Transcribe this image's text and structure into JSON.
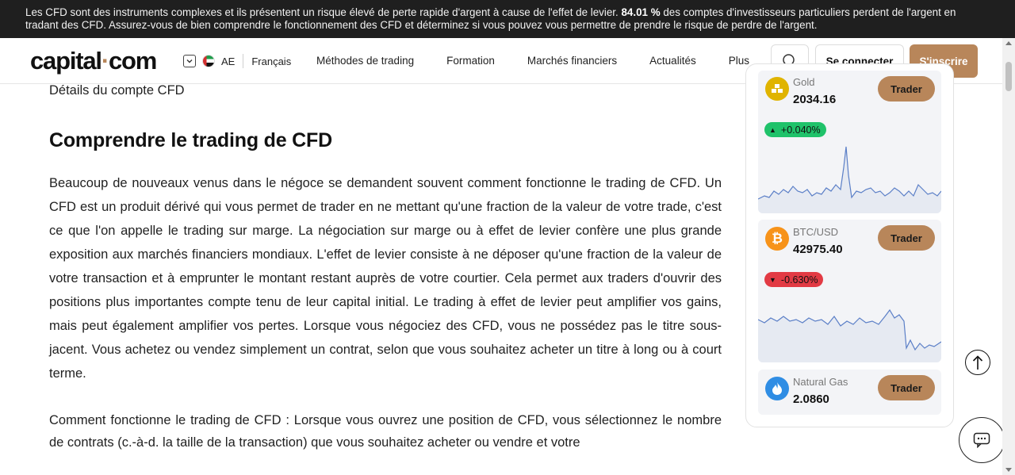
{
  "risk_banner": {
    "text_before": "Les CFD sont des instruments complexes et ils présentent un risque élevé de perte rapide d'argent à cause de l'effet de levier.",
    "percent": "84.01 %",
    "text_after": "des comptes d'investisseurs particuliers perdent de l'argent en tradant des CFD. Assurez-vous de bien comprendre le fonctionnement des CFD et déterminez si vous pouvez vous permettre de prendre le risque de perdre de l'argent."
  },
  "header": {
    "logo_part1": "capital",
    "logo_dot": "·",
    "logo_part2": "com",
    "region_code": "AE",
    "language": "Français",
    "nav": [
      "Méthodes de trading",
      "Formation",
      "Marchés financiers",
      "Actualités",
      "Plus"
    ],
    "login_label": "Se connecter",
    "signup_label": "S'inscrire"
  },
  "article": {
    "breadcrumb": "Détails du compte CFD",
    "heading": "Comprendre le trading de CFD",
    "paragraph1": "Beaucoup de nouveaux venus dans le négoce se demandent souvent comment fonctionne le trading de CFD. Un CFD est un produit dérivé qui vous permet de trader en ne mettant qu'une fraction de la valeur de votre trade, c'est ce que l'on appelle le trading sur marge. La négociation sur marge ou à effet de levier confère une plus grande exposition aux marchés financiers mondiaux. L'effet de levier consiste à ne déposer qu'une fraction de la valeur de votre transaction et à emprunter le montant restant auprès de votre courtier. Cela permet aux traders d'ouvrir des positions plus importantes compte tenu de leur capital initial. Le trading à effet de levier peut amplifier vos gains, mais peut également amplifier vos pertes. Lorsque vous négociez des CFD, vous ne possédez pas le titre sous-jacent. Vous achetez ou vendez simplement un contrat, selon que vous souhaitez acheter un titre à long ou à court terme.",
    "paragraph2": "Comment fonctionne le trading de CFD : Lorsque vous ouvrez une position de CFD, vous sélectionnez le nombre de contrats (c.-à-d. la taille de la transaction) que vous souhaitez acheter ou vendre et votre"
  },
  "instruments": [
    {
      "name": "Gold",
      "price": "2034.16",
      "change": "+0.040%",
      "direction": "up",
      "trade_label": "Trader",
      "icon": "gold-bars-icon",
      "icon_color": "#e0b400"
    },
    {
      "name": "BTC/USD",
      "price": "42975.40",
      "change": "-0.630%",
      "direction": "down",
      "trade_label": "Trader",
      "icon": "bitcoin-icon",
      "icon_color": "#f7931a"
    },
    {
      "name": "Natural Gas",
      "price": "2.0860",
      "trade_label": "Trader",
      "icon": "flame-icon",
      "icon_color": "#2f8de4"
    }
  ],
  "colors": {
    "accent": "#b8865a",
    "up": "#1fc26a",
    "down": "#e23a44",
    "banner_bg": "#1f1f1f"
  },
  "icons": {
    "search": "search-icon",
    "back_to_top": "arrow-up-icon",
    "chat": "chat-icon"
  }
}
